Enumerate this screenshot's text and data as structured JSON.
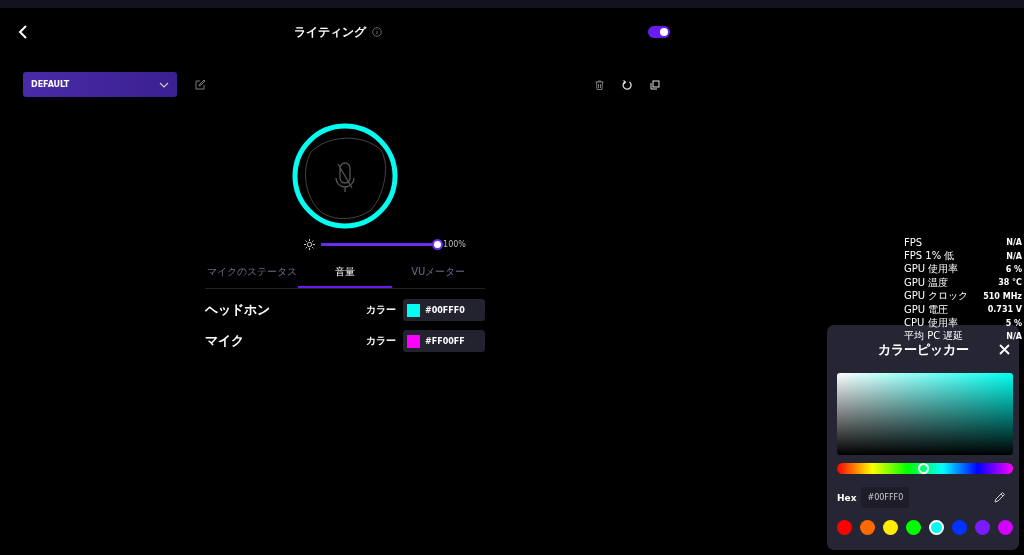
{
  "header": {
    "title": "ライティング",
    "enabled": true
  },
  "profile": {
    "value": "DEFAULT"
  },
  "brightness": {
    "level": 1.0,
    "reading": "100%"
  },
  "tabs": [
    {
      "label": "マイクのステータス",
      "selected": false
    },
    {
      "label": "音量",
      "selected": true
    },
    {
      "label": "VUメーター",
      "selected": false
    }
  ],
  "color_rows": [
    {
      "label": "ヘッドホン",
      "color_label": "カラー",
      "hex": "#00FFF0",
      "color": "#00fff0"
    },
    {
      "label": "マイク",
      "color_label": "カラー",
      "hex": "#FF00FF",
      "color": "#ff00ff"
    }
  ],
  "stats": [
    {
      "name": "FPS",
      "value": "N/A"
    },
    {
      "name": "FPS 1% 低",
      "value": "N/A"
    },
    {
      "name": "GPU 使用率",
      "value": "6 %"
    },
    {
      "name": "GPU 温度",
      "value": "38 °C"
    },
    {
      "name": "GPU クロック",
      "value": "510 MHz"
    },
    {
      "name": "GPU 電圧",
      "value": "0.731 V"
    },
    {
      "name": "CPU 使用率",
      "value": "5 %"
    },
    {
      "name": "平均 PC 遅延",
      "value": "N/A"
    }
  ],
  "color_picker": {
    "title": "カラーピッカー",
    "hue": {
      "level": 0.49
    },
    "hex_label": "Hex",
    "hex": "#00FFF0",
    "swatches": [
      {
        "color": "#ff0000",
        "selected": false
      },
      {
        "color": "#ff6a00",
        "selected": false
      },
      {
        "color": "#ffee00",
        "selected": false
      },
      {
        "color": "#00ff00",
        "selected": false
      },
      {
        "color": "#00fff0",
        "selected": true
      },
      {
        "color": "#0033ff",
        "selected": false
      },
      {
        "color": "#7a1aff",
        "selected": false
      },
      {
        "color": "#d100ff",
        "selected": false
      }
    ]
  }
}
